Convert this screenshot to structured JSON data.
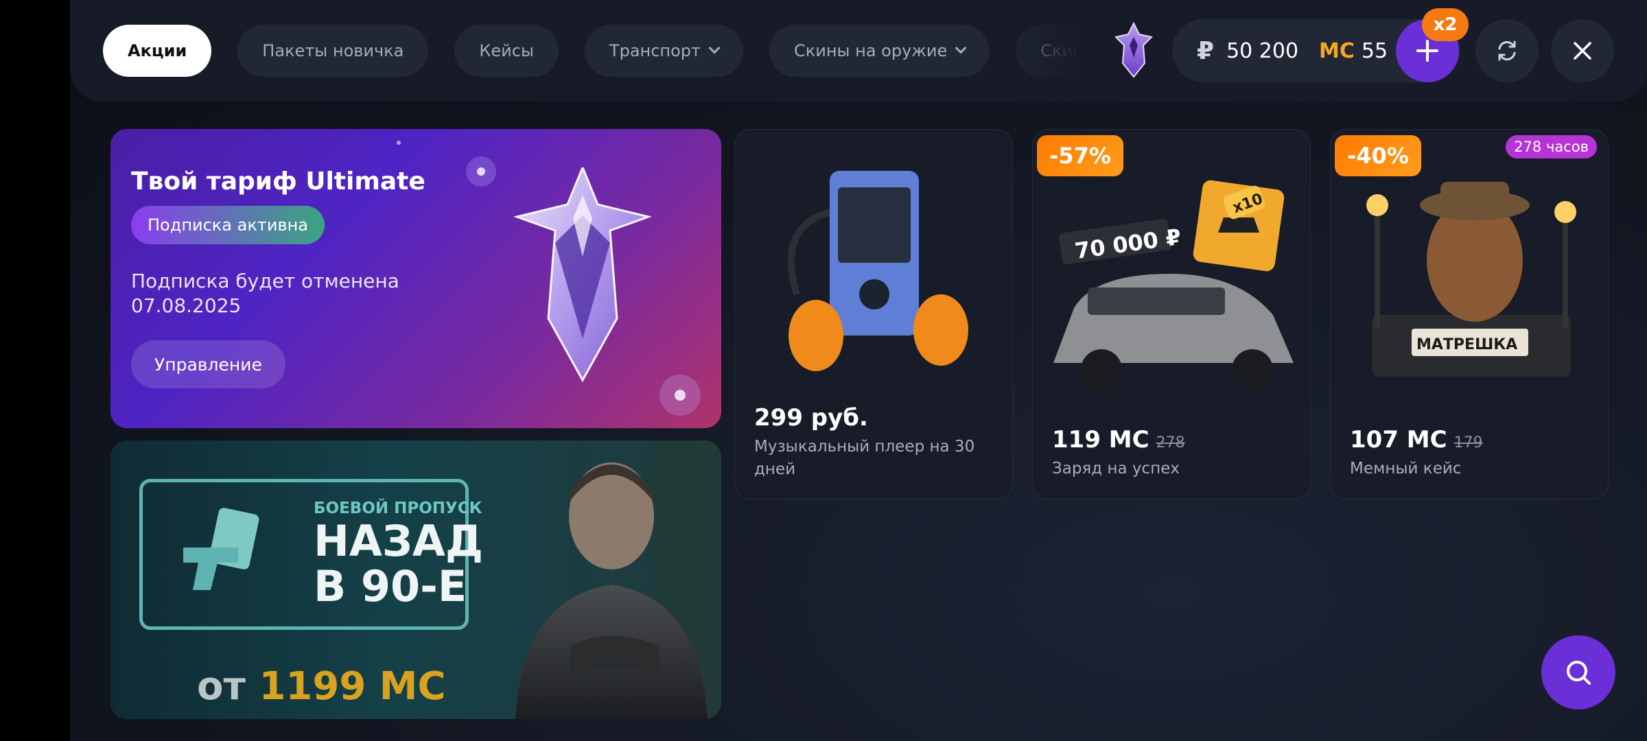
{
  "tabs": [
    {
      "label": "Акции",
      "active": true,
      "has_dropdown": false
    },
    {
      "label": "Пакеты новичка",
      "active": false,
      "has_dropdown": false
    },
    {
      "label": "Кейсы",
      "active": false,
      "has_dropdown": false
    },
    {
      "label": "Транспорт",
      "active": false,
      "has_dropdown": true
    },
    {
      "label": "Скины на оружие",
      "active": false,
      "has_dropdown": true
    },
    {
      "label": "Скины",
      "active": false,
      "has_dropdown": false
    }
  ],
  "balance": {
    "rub_symbol": "₽",
    "rub": "50 200",
    "mc_symbol": "MC",
    "mc": "55",
    "bonus_badge": "x2"
  },
  "colors": {
    "accent": "#6b2fd8",
    "discount": "#ff7a00",
    "mc": "#f5a623"
  },
  "icons": {
    "add": "plus-icon",
    "refresh": "refresh-icon",
    "close": "close-icon",
    "search": "search-icon"
  },
  "ultimate_banner": {
    "title": "Твой тариф Ultimate",
    "status_badge": "Подписка активна",
    "cancel_line1": "Подписка будет отменена",
    "cancel_line2": "07.08.2025",
    "manage_label": "Управление"
  },
  "battle_pass_banner": {
    "subtitle": "БОЕВОЙ ПРОПУСК",
    "title_line1": "НАЗАД",
    "title_line2": "В 90-Е",
    "price_prefix": "от",
    "price": "1199 MC"
  },
  "cards": [
    {
      "price": "299 руб.",
      "old_price": "",
      "name": "Музыкальный плеер на 30 дней",
      "discount": "",
      "timer": ""
    },
    {
      "price": "119 MC",
      "old_price": "278",
      "name": "Заряд на успех",
      "discount": "-57%",
      "timer": "",
      "art_text": "70 000 ₽",
      "art_badge": "x10"
    },
    {
      "price": "107 MC",
      "old_price": "179",
      "name": "Мемный кейс",
      "discount": "-40%",
      "timer": "278 часов",
      "art_text": "МАТРЕШКА"
    }
  ]
}
